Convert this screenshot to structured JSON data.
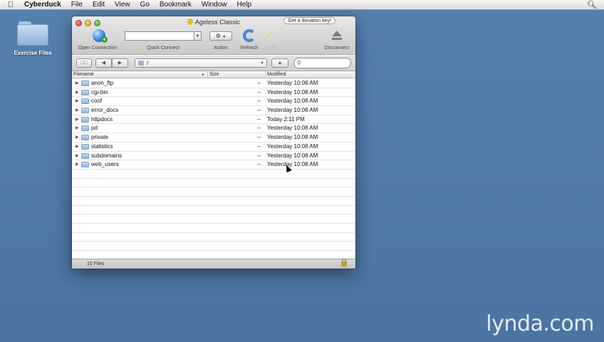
{
  "menubar": {
    "app_name": "Cyberduck",
    "items": [
      "File",
      "Edit",
      "View",
      "Go",
      "Bookmark",
      "Window",
      "Help"
    ]
  },
  "desktop": {
    "folder_label": "Exercise Files"
  },
  "window": {
    "title": "Ageless Classic",
    "donation_label": "Get a donation key!",
    "toolbar": {
      "open_connection": "Open Connection",
      "quick_connect": "Quick Connect",
      "action": "Action",
      "refresh": "Refresh",
      "edit": "Edit",
      "disconnect": "Disconnect"
    },
    "path": "/",
    "columns": {
      "filename": "Filename",
      "size": "Size",
      "modified": "Modified"
    },
    "files": [
      {
        "name": "anon_ftp",
        "size": "--",
        "modified": "Yesterday 10:08 AM"
      },
      {
        "name": "cgi-bin",
        "size": "--",
        "modified": "Yesterday 10:08 AM"
      },
      {
        "name": "conf",
        "size": "--",
        "modified": "Yesterday 10:08 AM"
      },
      {
        "name": "error_docs",
        "size": "--",
        "modified": "Yesterday 10:08 AM"
      },
      {
        "name": "httpdocs",
        "size": "--",
        "modified": "Today 2:11 PM"
      },
      {
        "name": "pd",
        "size": "--",
        "modified": "Yesterday 10:08 AM"
      },
      {
        "name": "private",
        "size": "--",
        "modified": "Yesterday 10:08 AM"
      },
      {
        "name": "statistics",
        "size": "--",
        "modified": "Yesterday 10:08 AM"
      },
      {
        "name": "subdomains",
        "size": "--",
        "modified": "Yesterday 10:08 AM"
      },
      {
        "name": "web_users",
        "size": "--",
        "modified": "Yesterday 10:08 AM"
      }
    ],
    "status": "10 Files"
  },
  "watermark": "lynda.com"
}
